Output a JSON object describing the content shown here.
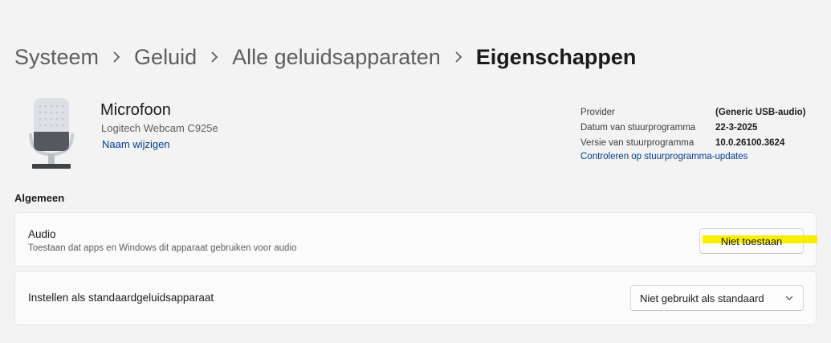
{
  "breadcrumb": {
    "items": [
      "Systeem",
      "Geluid",
      "Alle geluidsapparaten",
      "Eigenschappen"
    ]
  },
  "device": {
    "title": "Microfoon",
    "subtitle": "Logitech Webcam C925e",
    "rename_link": "Naam wijzigen"
  },
  "driver": {
    "provider_label": "Provider",
    "provider_value": "(Generic USB-audio)",
    "date_label": "Datum van stuurprogramma",
    "date_value": "22-3-2025",
    "version_label": "Versie van stuurprogramma",
    "version_value": "10.0.26100.3624",
    "update_link": "Controleren op stuurprogramma-updates"
  },
  "general": {
    "title": "Algemeen",
    "audio": {
      "title": "Audio",
      "description": "Toestaan dat apps en Windows dit apparaat gebruiken voor audio",
      "button_label": "Niet toestaan"
    },
    "default": {
      "title": "Instellen als standaardgeluidsapparaat",
      "selected": "Niet gebruikt als standaard"
    }
  },
  "colors": {
    "background": "#f3f3f3",
    "card": "#fbfbfb",
    "link": "#003e92",
    "highlight": "#f7ef00"
  },
  "icons": {
    "microphone": "microphone-icon",
    "breadcrumb_separator": "chevron-right-icon",
    "dropdown": "chevron-down-icon"
  }
}
